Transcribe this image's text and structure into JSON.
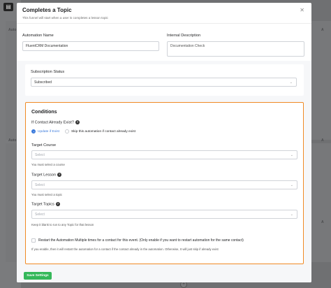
{
  "background": {
    "label_top": "Auto",
    "label_mid": "Auto",
    "label_right_top": "A",
    "label_right_mid": "A",
    "label_right_bottom": "A",
    "plus_glyph": "+"
  },
  "modal": {
    "title": "Completes a Topic",
    "subtitle": "This funnel will start when a user is completes a lesson topic",
    "close_glyph": "✕"
  },
  "automation_name": {
    "label": "Automation Name",
    "value": "FluentCRM Documentation"
  },
  "internal_description": {
    "label": "Internal Description",
    "value": "Documentation Check"
  },
  "subscription_status": {
    "label": "Subscription Status",
    "value": "Subscribed"
  },
  "conditions": {
    "title": "Conditions",
    "if_exists_label": "If Contact Already Exist?",
    "option_update": "Update if Exist",
    "option_skip": "Skip this automation if contact already exist",
    "selected_option": "update",
    "target_course": {
      "label": "Target Course",
      "placeholder": "Select",
      "hint": "You must select a course"
    },
    "target_lesson": {
      "label": "Target Lesson",
      "placeholder": "Select",
      "hint": "You must select a topic"
    },
    "target_topics": {
      "label": "Target Topics",
      "placeholder": "Select",
      "hint": "Keep it blank to run to any Topic for that lesson"
    },
    "restart_label": "Restart the Automation Multiple times for a contact for this event. (Only enable if you want to restart automation for the same contact)",
    "restart_checked": false,
    "restart_hint": "If you enable, then it will restart the automation for a contact if the contact already in the automation. Otherwise, It will just skip if already exist"
  },
  "footer": {
    "save_label": "Save Settings"
  },
  "colors": {
    "accent": "#f08a24",
    "primary": "#3c7bdc",
    "save": "#35b85a"
  }
}
